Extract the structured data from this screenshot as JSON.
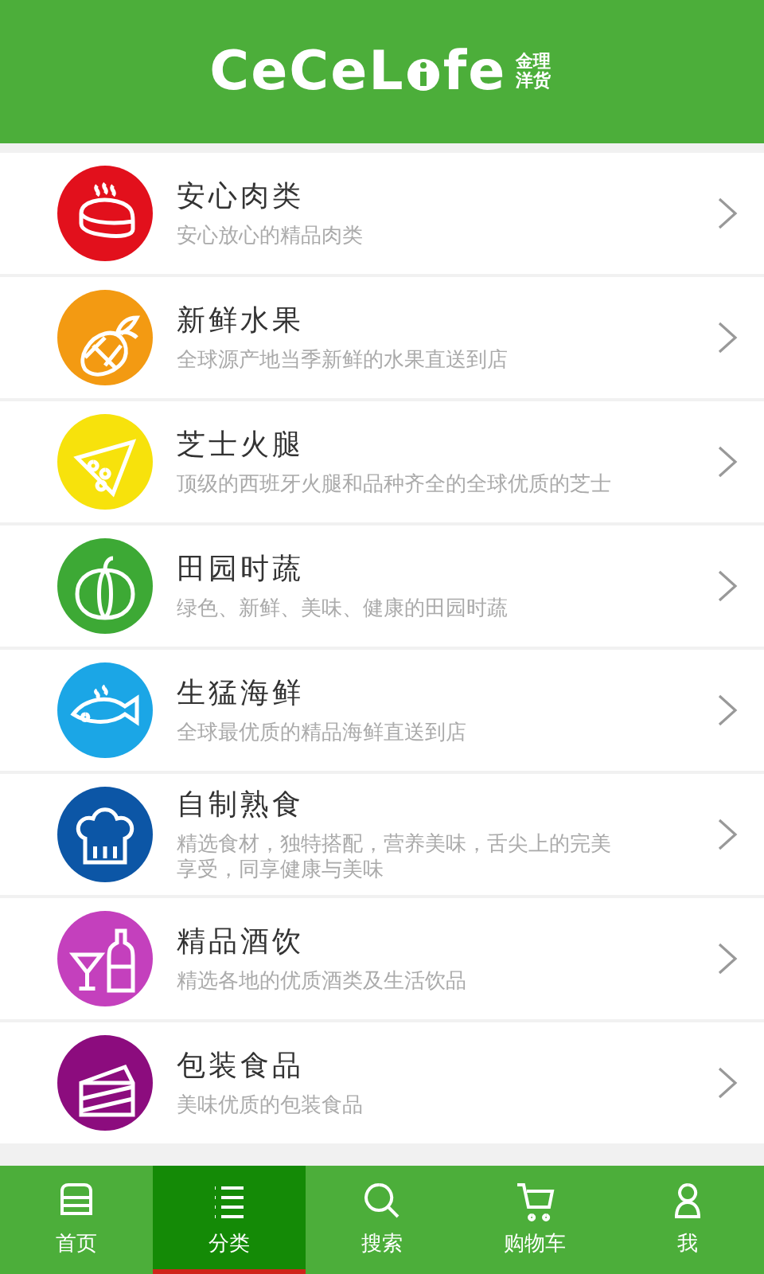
{
  "header": {
    "logo": "CeCeL",
    "logo_tail": "fe",
    "logo_badge": "金理洋货"
  },
  "categories": [
    {
      "kind": "meat",
      "color": "#e2101c",
      "title": "安心肉类",
      "description": "安心放心的精品肉类"
    },
    {
      "kind": "fruit",
      "color": "#f39a12",
      "title": "新鲜水果",
      "description": "全球源产地当季新鲜的水果直送到店"
    },
    {
      "kind": "cheese",
      "color": "#f7e20c",
      "title": "芝士火腿",
      "description": "顶级的西班牙火腿和品种齐全的全球优质的芝士"
    },
    {
      "kind": "vegetable",
      "color": "#3da935",
      "title": "田园时蔬",
      "description": "绿色、新鲜、美味、健康的田园时蔬"
    },
    {
      "kind": "seafood",
      "color": "#1ba6e6",
      "title": "生猛海鲜",
      "description": "全球最优质的精品海鲜直送到店"
    },
    {
      "kind": "deli",
      "color": "#0c56a6",
      "title": "自制熟食",
      "description": "精选食材，独特搭配，营养美味，舌尖上的完美享受，同享健康与美味"
    },
    {
      "kind": "drinks",
      "color": "#c440bd",
      "title": "精品酒饮",
      "description": "精选各地的优质酒类及生活饮品"
    },
    {
      "kind": "packaged",
      "color": "#8c0c7e",
      "title": "包装食品",
      "description": "美味优质的包装食品"
    }
  ],
  "tabs": [
    {
      "kind": "home",
      "label": "首页",
      "selected": false
    },
    {
      "kind": "category",
      "label": "分类",
      "selected": true
    },
    {
      "kind": "search",
      "label": "搜索",
      "selected": false
    },
    {
      "kind": "cart",
      "label": "购物车",
      "selected": false
    },
    {
      "kind": "me",
      "label": "我",
      "selected": false
    }
  ]
}
